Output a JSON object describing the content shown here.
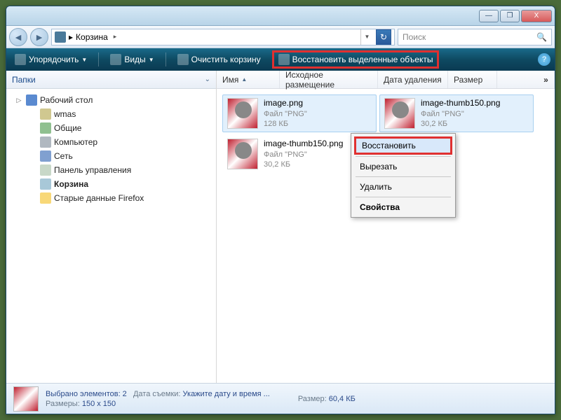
{
  "titlebar": {
    "min": "—",
    "max": "❐",
    "close": "X"
  },
  "nav": {
    "back": "◄",
    "fwd": "►"
  },
  "breadcrumb": {
    "location": "Корзина",
    "sep": "▸"
  },
  "search": {
    "placeholder": "Поиск",
    "icon": "🔍"
  },
  "toolbar": {
    "organize": "Упорядочить",
    "views": "Виды",
    "empty": "Очистить корзину",
    "restore": "Восстановить выделенные объекты",
    "help": "?"
  },
  "sidebar": {
    "title": "Папки",
    "items": [
      {
        "label": "Рабочий стол",
        "lvl": "l1",
        "ic": "icon-desktop",
        "exp": "▷"
      },
      {
        "label": "wmas",
        "lvl": "l2",
        "ic": "icon-user",
        "exp": ""
      },
      {
        "label": "Общие",
        "lvl": "l2",
        "ic": "icon-public",
        "exp": ""
      },
      {
        "label": "Компьютер",
        "lvl": "l2",
        "ic": "icon-computer",
        "exp": ""
      },
      {
        "label": "Сеть",
        "lvl": "l2",
        "ic": "icon-network",
        "exp": ""
      },
      {
        "label": "Панель управления",
        "lvl": "l2",
        "ic": "icon-control",
        "exp": ""
      },
      {
        "label": "Корзина",
        "lvl": "l2",
        "ic": "icon-recycle",
        "exp": "",
        "sel": true
      },
      {
        "label": "Старые данные Firefox",
        "lvl": "l2",
        "ic": "icon-folder",
        "exp": ""
      }
    ]
  },
  "columns": {
    "name": "Имя",
    "orig": "Исходное размещение",
    "deleted": "Дата удаления",
    "size": "Размер",
    "more": "»"
  },
  "files": [
    {
      "name": "image.png",
      "type": "Файл \"PNG\"",
      "size": "128 КБ",
      "sel": true
    },
    {
      "name": "image-thumb150.png",
      "type": "Файл \"PNG\"",
      "size": "30,2 КБ",
      "sel": true
    },
    {
      "name": "image-thumb150.png",
      "type": "Файл \"PNG\"",
      "size": "30,2 КБ",
      "sel": false
    }
  ],
  "context_menu": {
    "restore": "Восстановить",
    "cut": "Вырезать",
    "delete": "Удалить",
    "properties": "Свойства"
  },
  "status": {
    "selected_label": "Выбрано элементов: 2",
    "date_label": "Дата съемки:",
    "date_val": "Укажите дату и время ...",
    "dim_label": "Размеры:",
    "dim_val": "150 x 150",
    "size_label": "Размер:",
    "size_val": "60,4 КБ"
  }
}
